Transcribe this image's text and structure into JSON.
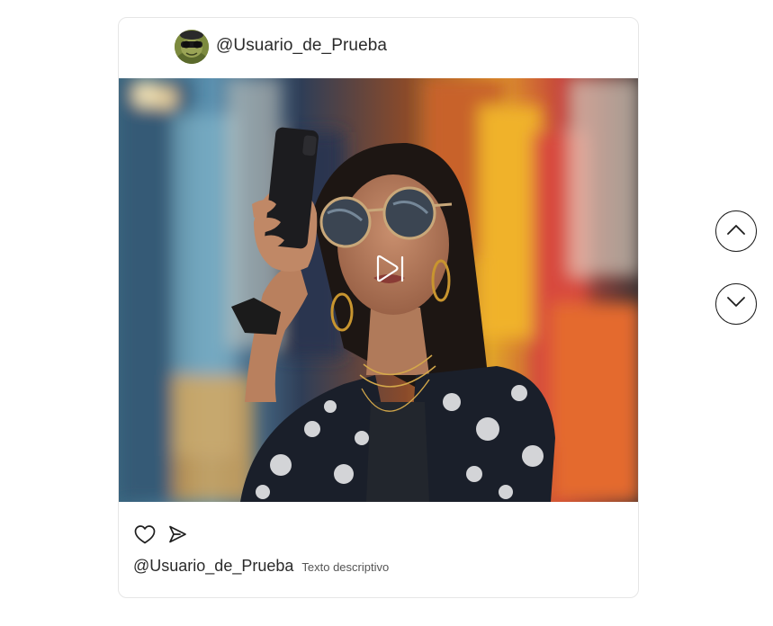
{
  "post": {
    "header_username": "@Usuario_de_Prueba",
    "caption_username": "@Usuario_de_Prueba",
    "caption_text": "Texto descriptivo"
  },
  "icons": {
    "avatar": "avatar",
    "play": "play-pause-icon",
    "like": "heart-icon",
    "share": "send-icon",
    "nav_up": "chevron-up-icon",
    "nav_down": "chevron-down-icon"
  },
  "colors": {
    "text": "#2b2b2b",
    "secondary_text": "#555555",
    "card_border": "#e6e6e6",
    "icon_stroke": "#1e1e1e"
  }
}
